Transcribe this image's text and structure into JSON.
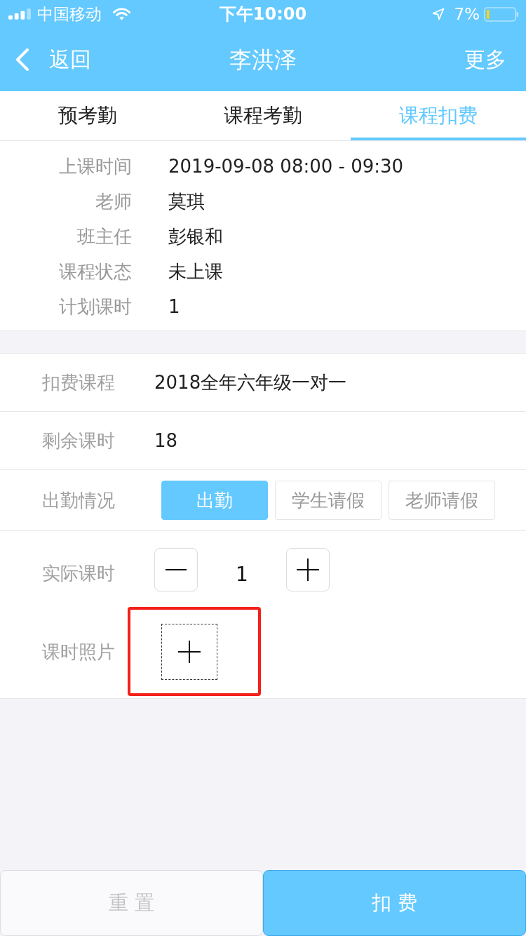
{
  "status_bar": {
    "carrier": "中国移动",
    "time": "下午10:00",
    "battery": "7%"
  },
  "nav_bar": {
    "back": "返回",
    "title": "李洪泽",
    "more": "更多"
  },
  "tabs": [
    {
      "label": "预考勤",
      "selected": false
    },
    {
      "label": "课程考勤",
      "selected": false
    },
    {
      "label": "课程扣费",
      "selected": true
    }
  ],
  "course_info": [
    {
      "label": "上课时间",
      "value": "2019-09-08 08:00 - 09:30"
    },
    {
      "label": "老师",
      "value": "莫琪"
    },
    {
      "label": "班主任",
      "value": "彭银和"
    },
    {
      "label": "课程状态",
      "value": "未上课"
    },
    {
      "label": "计划课时",
      "value": "1"
    }
  ],
  "form_rows": [
    {
      "kind": "text",
      "label": "扣费课程",
      "value": "2018全年六年级一对一"
    },
    {
      "kind": "text",
      "label": "剩余课时",
      "value": "18"
    },
    {
      "kind": "choice",
      "label": "出勤情况",
      "options": [
        {
          "label": "出勤",
          "selected": true
        },
        {
          "label": "学生请假",
          "selected": false
        },
        {
          "label": "老师请假",
          "selected": false
        }
      ]
    },
    {
      "kind": "stepper",
      "label": "实际课时",
      "value": "1"
    },
    {
      "kind": "photo",
      "label": "课时照片",
      "highlighted": true
    }
  ],
  "actions": [
    {
      "label": "重 置",
      "primary": false
    },
    {
      "label": "扣 费",
      "primary": true
    }
  ]
}
